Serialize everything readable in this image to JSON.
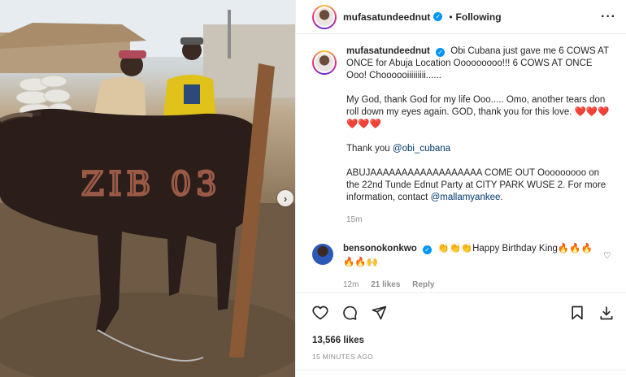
{
  "post": {
    "username": "mufasatundeednut",
    "follow_status": "Following",
    "caption": {
      "username": "mufasatundeednut",
      "line1": "Obi Cubana just gave me 6 COWS AT ONCE for Abuja Location Ooooooooo!!! 6 COWS AT ONCE Ooo! Choooooiiiiiiiii......",
      "line2": "My God, thank God for my life Ooo..... Omo, another tears don roll down my eyes again. GOD, thank you for this love.",
      "line2_hearts": "❤️❤️❤️❤️❤️❤️",
      "thanks_prefix": "Thank you ",
      "thanks_mention": "@obi_cubana",
      "line4": "ABUJAAAAAAAAAAAAAAAAAA COME OUT Ooooooooo on the 22nd Tunde Ednut Party at CITY PARK WUSE 2. For more information, contact ",
      "line4_mention": "@mallamyankee",
      "line4_end": ".",
      "time": "15m"
    },
    "comment": {
      "username": "bensonokonkwo",
      "text": "👏👏👏Happy Birthday King🔥🔥🔥🔥🔥🙌",
      "time": "12m",
      "likes": "21 likes",
      "reply": "Reply"
    },
    "likes": "13,566 likes",
    "posted_ago": "15 MINUTES AGO"
  },
  "photo": {
    "brand_text": "ZIB 03"
  },
  "icons": {
    "verified": "verified-badge",
    "like": "heart-icon",
    "comment": "comment-icon",
    "share": "send-icon",
    "save": "bookmark-icon",
    "download": "download-icon",
    "more": "more-dots-icon",
    "next": "chevron-right-icon"
  },
  "colors": {
    "verified": "#0095f6",
    "mention": "#00376b",
    "secondary_text": "#8e8e8e"
  }
}
